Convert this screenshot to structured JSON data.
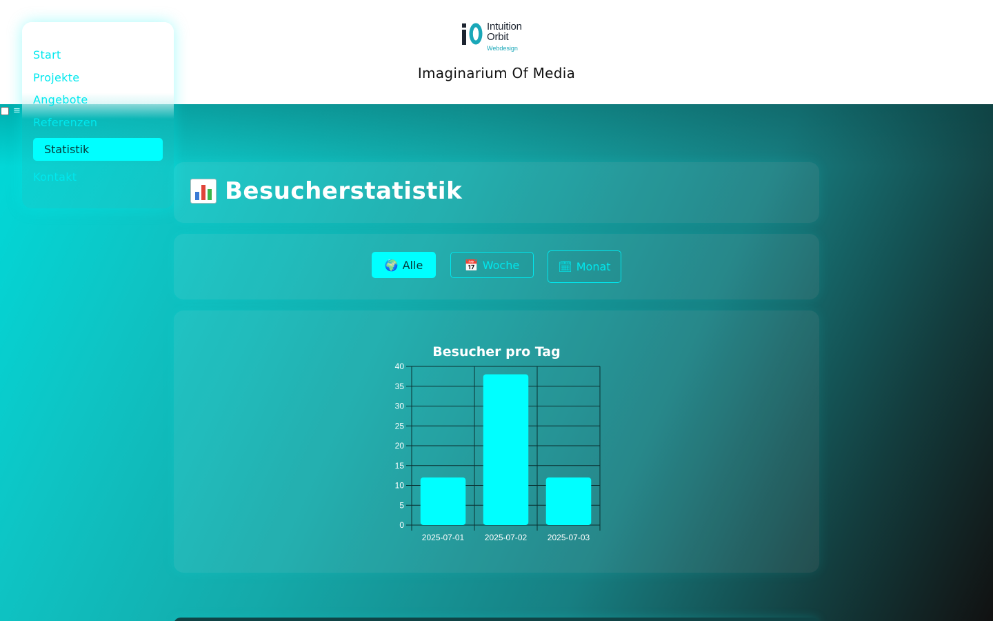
{
  "header": {
    "logo_line1": "Intuition",
    "logo_line2": "Orbit",
    "logo_sub": "Webdesign",
    "site_title": "Imaginarium Of Media"
  },
  "sidebar": {
    "items": [
      {
        "label": "Start"
      },
      {
        "label": "Projekte"
      },
      {
        "label": "Angebote"
      },
      {
        "label": "Referenzen"
      },
      {
        "label": "Statistik",
        "active": true
      },
      {
        "label": "Kontakt"
      }
    ],
    "menu_icon": "hamburger-icon"
  },
  "main": {
    "heading": "Besucherstatistik",
    "heading_icon": "bar-chart-icon",
    "filters": [
      {
        "icon": "globe-icon",
        "glyph": "🌍",
        "label": "Alle",
        "active": true
      },
      {
        "icon": "calendar-icon",
        "glyph": "📅",
        "label": "Woche",
        "active": false
      },
      {
        "icon": "month-calendar-icon",
        "glyph": "🗓",
        "label": "Monat",
        "active": false
      }
    ]
  },
  "colors": {
    "accent": "#00ffff",
    "nav_text": "#00e8ee",
    "bar": "#00ffff"
  },
  "chart_data": {
    "type": "bar",
    "title": "Besucher pro Tag",
    "categories": [
      "2025-07-01",
      "2025-07-02",
      "2025-07-03"
    ],
    "values": [
      12,
      38,
      12
    ],
    "ylim": [
      0,
      40
    ],
    "yticks": [
      0,
      5,
      10,
      15,
      20,
      25,
      30,
      35,
      40
    ],
    "grid": true,
    "legend": "none"
  }
}
